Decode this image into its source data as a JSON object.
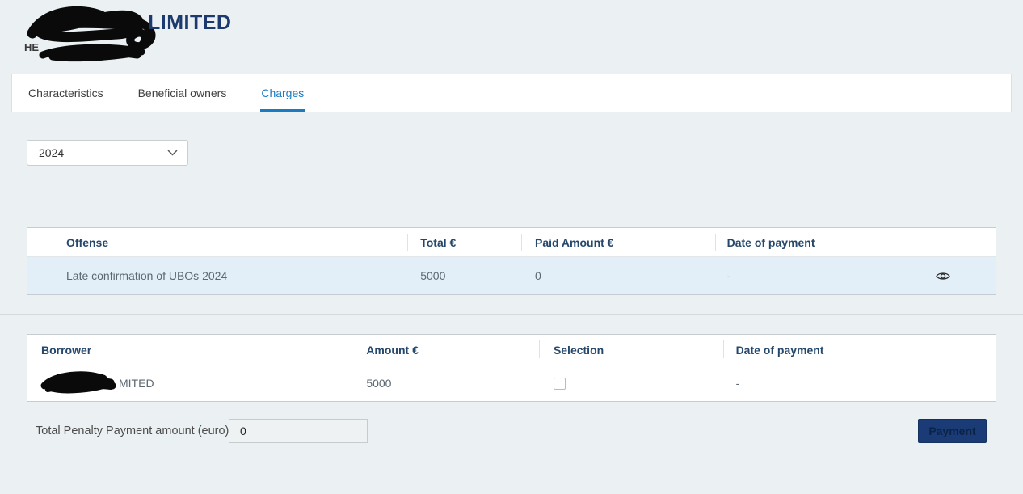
{
  "colors": {
    "page_background": "#ebf1f3",
    "accent_blue": "#1a7bc0",
    "brand_navy": "#1c3a6e",
    "table_header_text": "#25476b",
    "highlight_row": "#e2eff8",
    "payment_button_bg": "#1a3b76"
  },
  "header": {
    "company_name_visible_suffix": "LIMITED",
    "registration_visible_prefix": "HE"
  },
  "tabs": [
    {
      "label": "Characteristics",
      "active": false
    },
    {
      "label": "Beneficial owners",
      "active": false
    },
    {
      "label": "Charges",
      "active": true
    }
  ],
  "year_select": {
    "value": "2024",
    "icon": "chevron-down"
  },
  "charges_table": {
    "columns": [
      "Offense",
      "Total €",
      "Paid Amount €",
      "Date of payment"
    ],
    "action_icon": "eye",
    "rows": [
      {
        "offense": "Late confirmation of UBOs 2024",
        "total": "5000",
        "paid": "0",
        "date_of_payment": "-"
      }
    ]
  },
  "borrowers_table": {
    "columns": [
      "Borrower",
      "Amount €",
      "Selection",
      "Date of payment"
    ],
    "rows": [
      {
        "borrower_visible_suffix": "MITED",
        "amount": "5000",
        "selected": false,
        "date_of_payment": "-"
      }
    ]
  },
  "footer": {
    "total_label": "Total Penalty Payment amount (euro) :",
    "total_value": "0",
    "payment_button_label": "Payment"
  }
}
